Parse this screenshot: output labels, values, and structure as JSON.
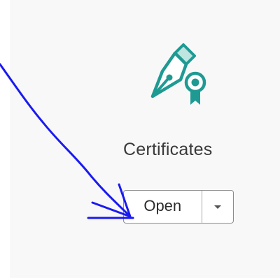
{
  "tool": {
    "label": "Certificates",
    "icon": "pen-nib-certificate-icon",
    "accent_color": "#1f9a93",
    "accent_light": "#bfe5e1"
  },
  "open_button": {
    "label": "Open",
    "dropdown_icon": "chevron-down-icon"
  },
  "annotation": {
    "color": "#1a1af0",
    "icon": "hand-drawn-arrow"
  }
}
